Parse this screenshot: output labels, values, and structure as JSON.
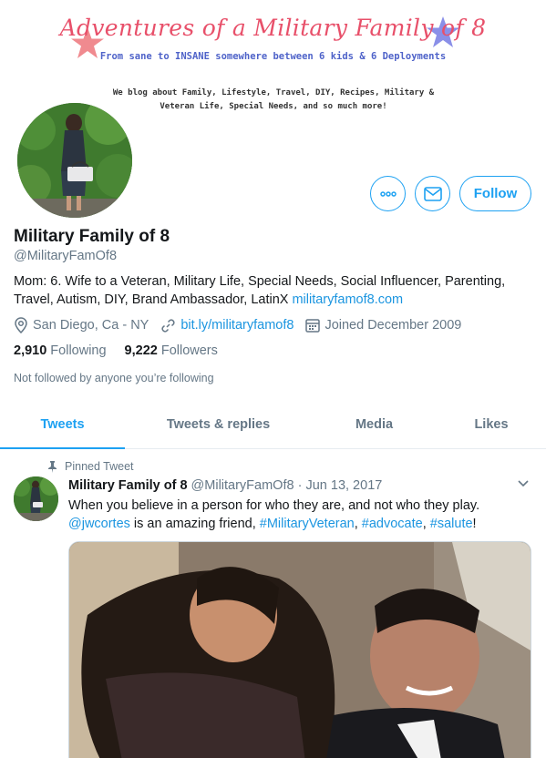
{
  "banner": {
    "title": "Adventures of a Military Family of 8",
    "subtitle": "From sane to INSANE somewhere between 6 kids & 6 Deployments",
    "description": "We blog about Family, Lifestyle, Travel, DIY, Recipes, Military & Veteran Life, Special Needs, and so much more!",
    "star_pink": "#f08a8f",
    "star_blue": "#8a8fe8"
  },
  "profile": {
    "name": "Military Family of 8",
    "handle": "@MilitaryFamOf8",
    "bio": "Mom: 6. Wife to a Veteran, Military Life, Special Needs, Social Influencer, Parenting, Travel, Autism, DIY, Brand Ambassador, LatinX ",
    "bio_link": "militaryfamof8.com",
    "location": "San Diego, Ca - NY",
    "website": "bit.ly/militaryfamof8",
    "joined": "Joined December 2009",
    "following_count": "2,910",
    "following_label": "Following",
    "followers_count": "9,222",
    "followers_label": "Followers",
    "not_followed": "Not followed by anyone you’re following"
  },
  "actions": {
    "follow_label": "Follow",
    "more_icon": "more-icon",
    "message_icon": "envelope-icon"
  },
  "tabs": [
    {
      "label": "Tweets",
      "active": true
    },
    {
      "label": "Tweets & replies",
      "active": false
    },
    {
      "label": "Media",
      "active": false
    },
    {
      "label": "Likes",
      "active": false
    }
  ],
  "tweet": {
    "pinned_label": "Pinned Tweet",
    "author": "Military Family of 8",
    "handle": "@MilitaryFamOf8",
    "separator": "·",
    "date": "Jun 13, 2017",
    "text_1": "When you believe in a person for who they are, and not who they play.",
    "mention": "@jwcortes",
    "text_2": " is an amazing friend, ",
    "tag_1": "#MilitaryVeteran",
    "comma_1": ", ",
    "tag_2": "#advocate",
    "comma_2": ", ",
    "tag_3": "#salute",
    "text_end": "!"
  },
  "colors": {
    "accent": "#1da1f2",
    "link": "#1b95e0",
    "muted": "#657786"
  }
}
